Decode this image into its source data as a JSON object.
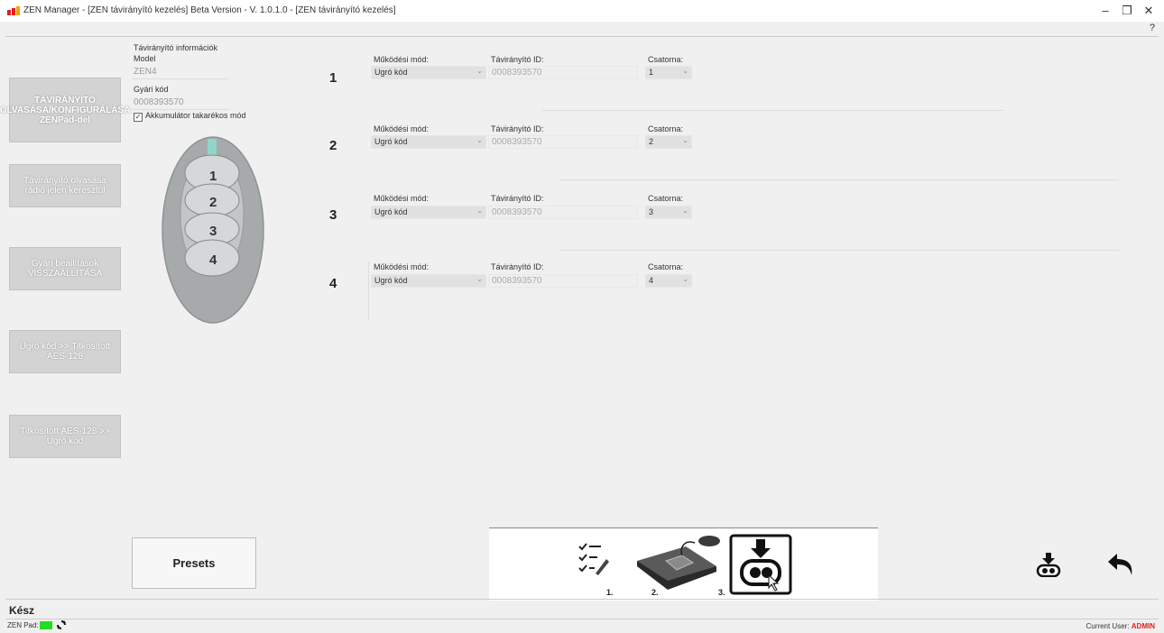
{
  "window": {
    "title": "ZEN Manager - [ZEN távirányító kezelés] Beta Version - V. 1.0.1.0 - [ZEN távirányító kezelés]",
    "minimize_glyph": "–",
    "restore_glyph": "❐",
    "close_glyph": "✕",
    "help_glyph": "?"
  },
  "sidebar": {
    "items": [
      {
        "label": "TÁVIRÁNYÍTÓ OLVASÁSA/KONFIGURÁLÁSA ZENPad-del"
      },
      {
        "label": "Távirányító olvasása rádió jelen keresztül"
      },
      {
        "label": "Gyári beállítások VISSZAÁLLÍTÁSA"
      },
      {
        "label": "Ugró kód >> Titkosított AES-128"
      },
      {
        "label": "Titkosított AES-128 >> Ugró kód"
      }
    ]
  },
  "info": {
    "section_title": "Távirányító információk",
    "model_label": "Model",
    "model_value": "ZEN4",
    "factory_code_label": "Gyári kód",
    "factory_code_value": "0008393570",
    "battery_saver_label": "Akkumulátor takarékos mód",
    "battery_saver_checked_glyph": "✓"
  },
  "remote": {
    "buttons": [
      "1",
      "2",
      "3",
      "4"
    ]
  },
  "channels": [
    {
      "number": "1",
      "mode_label": "Működési mód:",
      "mode_value": "Ugró kód",
      "id_label": "Távirányító ID:",
      "id_value": "0008393570",
      "channel_label": "Csatorna:",
      "channel_value": "1"
    },
    {
      "number": "2",
      "mode_label": "Működési mód:",
      "mode_value": "Ugró kód",
      "id_label": "Távirányító ID:",
      "id_value": "0008393570",
      "channel_label": "Csatorna:",
      "channel_value": "2"
    },
    {
      "number": "3",
      "mode_label": "Működési mód:",
      "mode_value": "Ugró kód",
      "id_label": "Távirányító ID:",
      "id_value": "0008393570",
      "channel_label": "Csatorna:",
      "channel_value": "3"
    },
    {
      "number": "4",
      "mode_label": "Működési mód:",
      "mode_value": "Ugró kód",
      "id_label": "Távirányító ID:",
      "id_value": "0008393570",
      "channel_label": "Csatorna:",
      "channel_value": "4"
    }
  ],
  "dropdown_arrow": "⌄",
  "presets_label": "Presets",
  "steps": {
    "labels": [
      "1.",
      "2.",
      "3."
    ]
  },
  "status": {
    "text": "Kész",
    "zenpad_label": "ZEN Pad:",
    "current_user_label": "Current User:",
    "current_user_value": "ADMIN"
  },
  "colors": {
    "accent_red": "#e02020",
    "status_green": "#22dd22"
  }
}
